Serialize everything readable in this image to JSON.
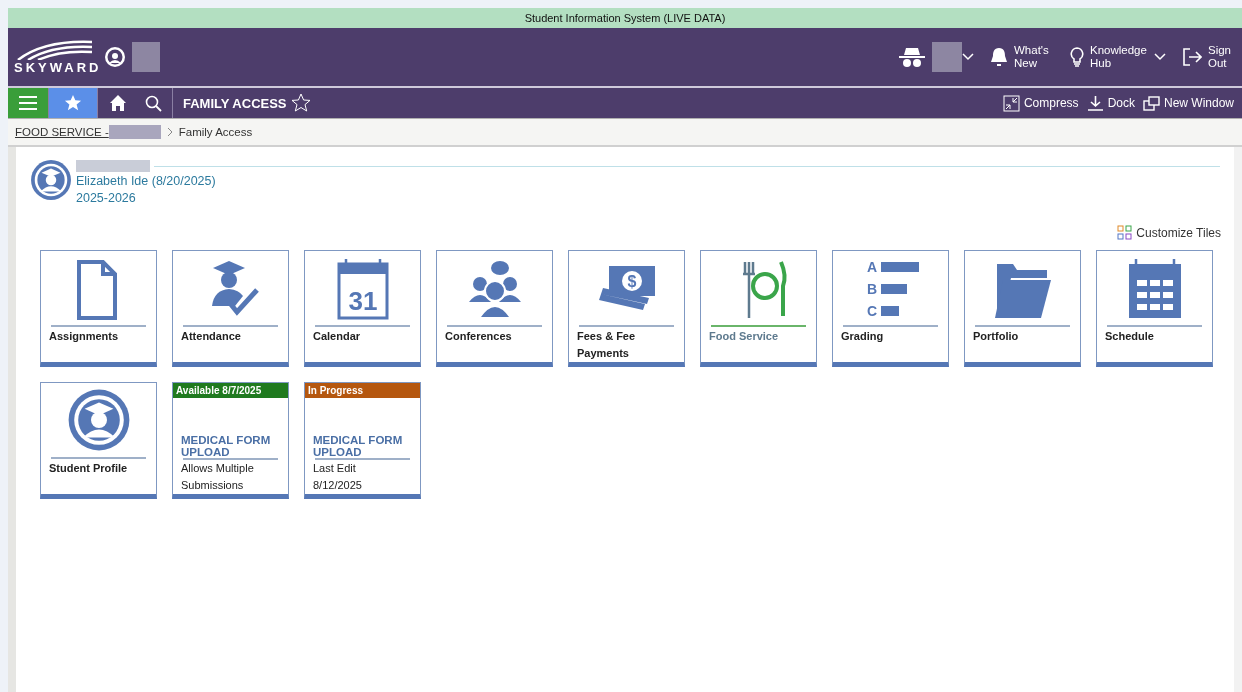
{
  "system_bar": {
    "title": "Student Information System (LIVE DATA)"
  },
  "header": {
    "logo_text": "SKYWARD",
    "whats_new": "What's New",
    "knowledge_hub": "Knowledge Hub",
    "sign_out": "Sign Out"
  },
  "nav": {
    "title": "FAMILY ACCESS",
    "actions": [
      {
        "kind": "compress",
        "label": "Compress"
      },
      {
        "kind": "dock",
        "label": "Dock"
      },
      {
        "kind": "window",
        "label": "New Window"
      }
    ]
  },
  "breadcrumb": {
    "link": "FOOD SERVICE -",
    "current": "Family Access"
  },
  "student": {
    "name_line": "Elizabeth Ide (8/20/2025)",
    "year": "2025-2026"
  },
  "customize": "Customize Tiles",
  "tiles": [
    {
      "kind": "assignments",
      "label": "Assignments",
      "highlighted": false
    },
    {
      "kind": "attendance",
      "label": "Attendance",
      "highlighted": false
    },
    {
      "kind": "calendar",
      "label": "Calendar",
      "icon_text": "31",
      "highlighted": false
    },
    {
      "kind": "conferences",
      "label": "Conferences",
      "highlighted": false
    },
    {
      "kind": "fees",
      "label": "Fees & Fee Payments",
      "icon_text": "$",
      "highlighted": false
    },
    {
      "kind": "food",
      "label": "Food Service",
      "highlighted": true
    },
    {
      "kind": "grading",
      "label": "Grading",
      "icon_letters": [
        "A",
        "B",
        "C"
      ],
      "highlighted": false
    },
    {
      "kind": "portfolio",
      "label": "Portfolio",
      "highlighted": false
    },
    {
      "kind": "schedule",
      "label": "Schedule",
      "highlighted": false
    },
    {
      "kind": "profile",
      "label": "Student Profile",
      "highlighted": false
    },
    {
      "kind": "form",
      "banner": "Available 8/7/2025",
      "color": "#1f7a1f",
      "title": "MEDICAL FORM UPLOAD",
      "lines": [
        "Allows Multiple",
        "Submissions"
      ]
    },
    {
      "kind": "form",
      "banner": "In Progress",
      "color": "#b5570f",
      "title": "MEDICAL FORM UPLOAD",
      "lines": [
        "Last Edit",
        "8/12/2025"
      ]
    }
  ]
}
